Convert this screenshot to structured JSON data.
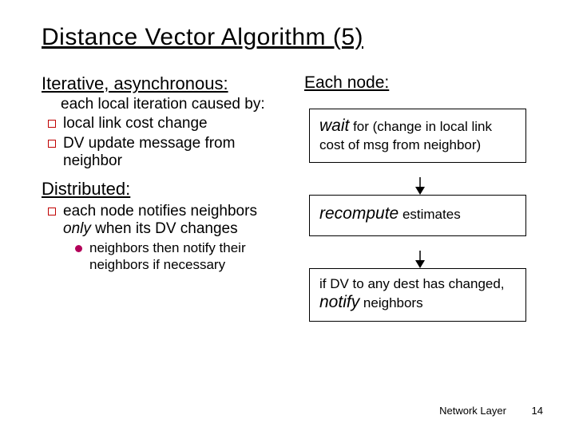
{
  "title": "Distance Vector Algorithm (5)",
  "left": {
    "h1": "Iterative, asynchronous:",
    "intro": "each local iteration caused by:",
    "b1": "local link cost change",
    "b2": "DV update message from neighbor",
    "h2": "Distributed:",
    "b3a": "each node notifies neighbors ",
    "b3_only": "only",
    "b3b": " when its DV changes",
    "n1": "neighbors then notify their neighbors if necessary"
  },
  "right": {
    "head": "Each node:",
    "box1_em": "wait",
    "box1_rest": " for (change in local link cost of msg from neighbor)",
    "box2_em": "recompute",
    "box2_rest": " estimates",
    "box3a": "if DV to any dest has changed, ",
    "box3_em": "notify",
    "box3b": " neighbors"
  },
  "footer": {
    "label": "Network Layer",
    "page": "14"
  }
}
